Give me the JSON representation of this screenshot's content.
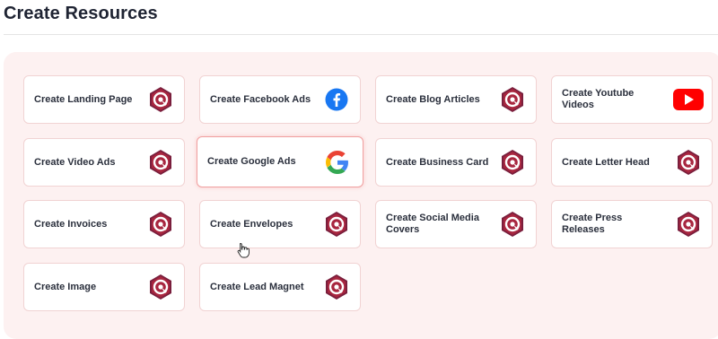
{
  "header": {
    "title": "Create Resources"
  },
  "cards": [
    {
      "label": "Create Landing Page",
      "icon": "brand-logo-icon"
    },
    {
      "label": "Create Facebook Ads",
      "icon": "facebook-icon"
    },
    {
      "label": "Create Blog Articles",
      "icon": "brand-logo-icon"
    },
    {
      "label": "Create Youtube Videos",
      "icon": "youtube-icon"
    },
    {
      "label": "Create Video Ads",
      "icon": "brand-logo-icon"
    },
    {
      "label": "Create Google Ads",
      "icon": "google-icon",
      "selected": true
    },
    {
      "label": "Create Business Card",
      "icon": "brand-logo-icon"
    },
    {
      "label": "Create Letter Head",
      "icon": "brand-logo-icon"
    },
    {
      "label": "Create Invoices",
      "icon": "brand-logo-icon"
    },
    {
      "label": "Create Envelopes",
      "icon": "brand-logo-icon"
    },
    {
      "label": "Create Social Media Covers",
      "icon": "brand-logo-icon"
    },
    {
      "label": "Create Press Releases",
      "icon": "brand-logo-icon"
    },
    {
      "label": "Create Image",
      "icon": "brand-logo-icon"
    },
    {
      "label": "Create Lead Magnet",
      "icon": "brand-logo-icon"
    }
  ],
  "colors": {
    "accent": "#f0a0a0",
    "brand_logo_dark": "#7a1f3d",
    "facebook": "#1877f2",
    "youtube": "#ff0000"
  }
}
